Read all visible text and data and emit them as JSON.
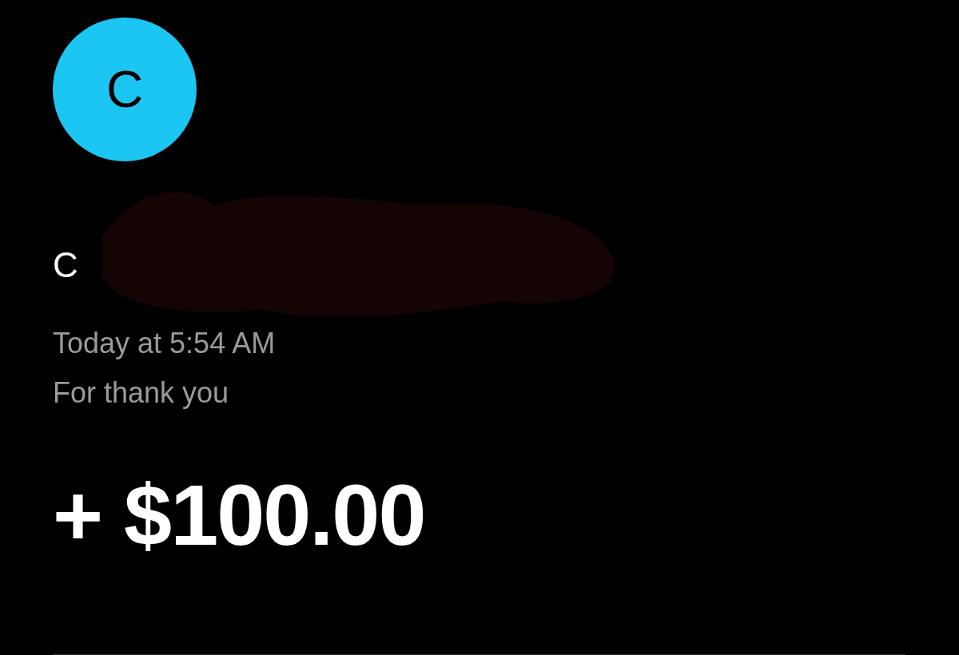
{
  "contact": {
    "avatar_letter": "C",
    "name": "C"
  },
  "timestamp": "Today at 5:54 AM",
  "note": "For thank you",
  "amount": "+ $100.00"
}
